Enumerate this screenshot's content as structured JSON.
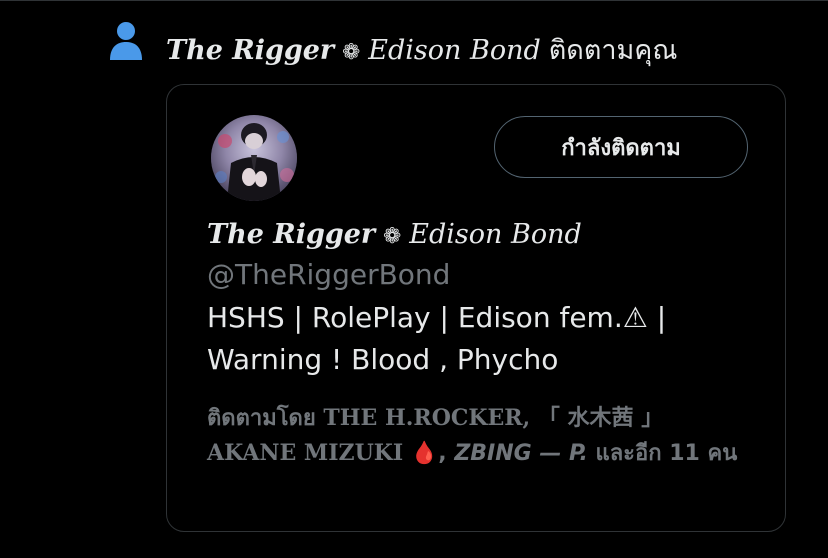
{
  "notification": {
    "icon": "person-icon",
    "icon_color": "#4a99e9",
    "name_part1": "The Rigger",
    "name_symbol": "❁",
    "name_part2": "Edison Bond",
    "action_text": "ติดตามคุณ"
  },
  "profile_card": {
    "avatar": "profile-avatar",
    "follow_button_label": "กำลังติดตาม",
    "display_name_part1": "The Rigger",
    "display_name_symbol": "❁",
    "display_name_part2": "Edison Bond",
    "handle": "@TheRiggerBond",
    "bio_line1": "HSHS | RolePlay | Edison fem.⚠ |",
    "bio_line2": "Warning ! Blood , Phycho",
    "followed_by": {
      "prefix": "ติดตามโดย",
      "follower1": "THE H.ROCKER,",
      "follower2_line1": "「 水木茜 」",
      "follower2_line2": "AKANE MIZUKI",
      "follower2_emoji": "🩸",
      "separator": ",",
      "follower3": "ZBING — P.",
      "suffix_and": "และอีก",
      "count": "11",
      "unit": "คน"
    }
  },
  "colors": {
    "background": "#000000",
    "primary_text": "#e7e9ea",
    "secondary_text": "#71767b",
    "border": "#2f3336",
    "accent_blue": "#4a99e9"
  }
}
